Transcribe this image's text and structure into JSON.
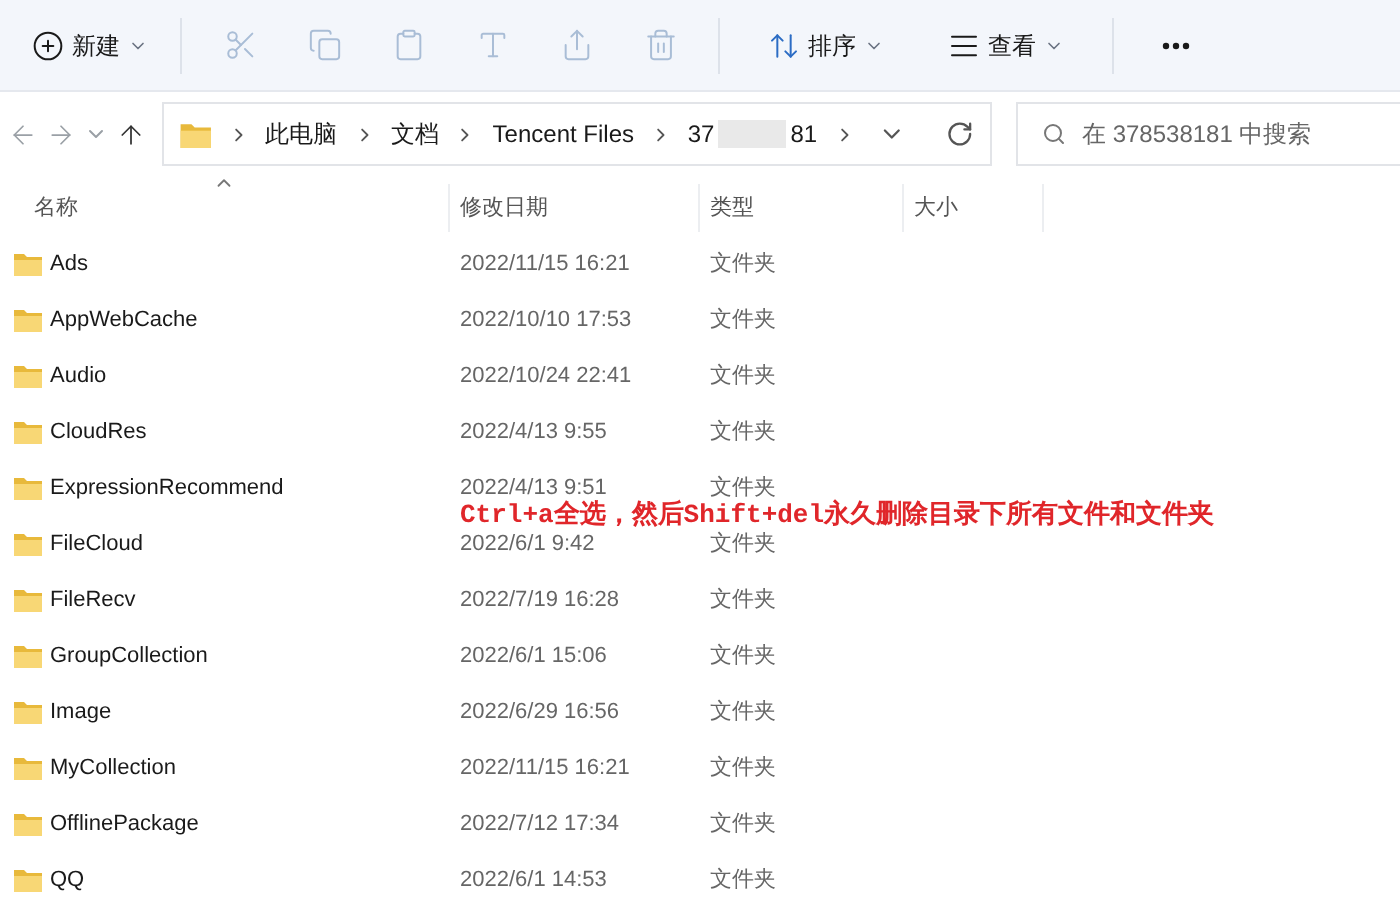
{
  "toolbar": [
    {
      "kind": "new",
      "label": "新建",
      "disabled": false
    },
    {
      "kind": "icon",
      "disabled": true
    },
    {
      "kind": "icon",
      "disabled": true
    },
    {
      "kind": "icon",
      "disabled": true
    },
    {
      "kind": "icon",
      "disabled": true
    },
    {
      "kind": "icon",
      "disabled": true
    },
    {
      "kind": "icon",
      "disabled": true
    },
    {
      "kind": "sort",
      "label": "排序",
      "disabled": false
    },
    {
      "kind": "view",
      "label": "查看",
      "disabled": false
    },
    {
      "kind": "more",
      "disabled": false
    }
  ],
  "breadcrumbs": [
    {
      "label": "此电脑"
    },
    {
      "label": "文档"
    },
    {
      "label": "Tencent Files"
    },
    {
      "label": "37",
      "redacted": true,
      "label_end": "81"
    }
  ],
  "search": {
    "placeholder": "在 378538181 中搜索"
  },
  "table": {
    "columns": [
      {
        "label": "名称",
        "sorted": true
      },
      {
        "label": "修改日期",
        "sorted": false
      },
      {
        "label": "类型",
        "sorted": false
      },
      {
        "label": "大小",
        "sorted": false
      }
    ],
    "rows": [
      {
        "name": "Ads",
        "date": "2022/11/15 16:21",
        "type": "文件夹"
      },
      {
        "name": "AppWebCache",
        "date": "2022/10/10 17:53",
        "type": "文件夹"
      },
      {
        "name": "Audio",
        "date": "2022/10/24 22:41",
        "type": "文件夹"
      },
      {
        "name": "CloudRes",
        "date": "2022/4/13 9:55",
        "type": "文件夹"
      },
      {
        "name": "ExpressionRecommend",
        "date": "2022/4/13 9:51",
        "type": "文件夹"
      },
      {
        "name": "FileCloud",
        "date": "2022/6/1 9:42",
        "type": "文件夹"
      },
      {
        "name": "FileRecv",
        "date": "2022/7/19 16:28",
        "type": "文件夹"
      },
      {
        "name": "GroupCollection",
        "date": "2022/6/1 15:06",
        "type": "文件夹"
      },
      {
        "name": "Image",
        "date": "2022/6/29 16:56",
        "type": "文件夹"
      },
      {
        "name": "MyCollection",
        "date": "2022/11/15 16:21",
        "type": "文件夹"
      },
      {
        "name": "OfflinePackage",
        "date": "2022/7/12 17:34",
        "type": "文件夹"
      },
      {
        "name": "QQ",
        "date": "2022/6/1 14:53",
        "type": "文件夹"
      }
    ]
  },
  "annotation": "Ctrl+a全选，然后Shift+del永久删除目录下所有文件和文件夹"
}
